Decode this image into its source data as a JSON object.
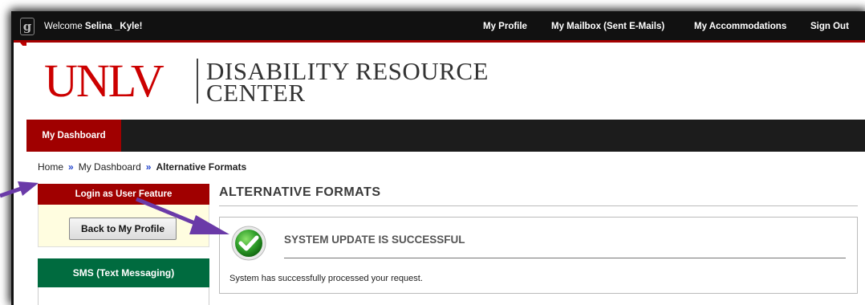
{
  "topbar": {
    "welcome_prefix": "Welcome",
    "user_name": "Selina _Kyle!",
    "links": [
      "My Profile",
      "My Mailbox (Sent E-Mails)",
      "My Accommodations",
      "Sign Out"
    ]
  },
  "header": {
    "logo_text": "UNLV",
    "center_line1": "DISABILITY RESOURCE",
    "center_line2": "CENTER"
  },
  "nav": {
    "dashboard_tab": "My Dashboard"
  },
  "breadcrumb": {
    "items": [
      "Home",
      "My Dashboard",
      "Alternative Formats"
    ],
    "separator": "»"
  },
  "sidebar": {
    "login_feature_title": "Login as User Feature",
    "back_button": "Back to My Profile",
    "sms_title": "SMS (Text Messaging)"
  },
  "main": {
    "title": "ALTERNATIVE FORMATS",
    "message_heading": "SYSTEM UPDATE IS SUCCESSFUL",
    "message_body": "System has successfully processed your request."
  },
  "colors": {
    "brand_red": "#cc0000",
    "dark_red": "#a00000",
    "sms_green": "#006b3f",
    "annotation_purple": "#6a3aa8"
  }
}
